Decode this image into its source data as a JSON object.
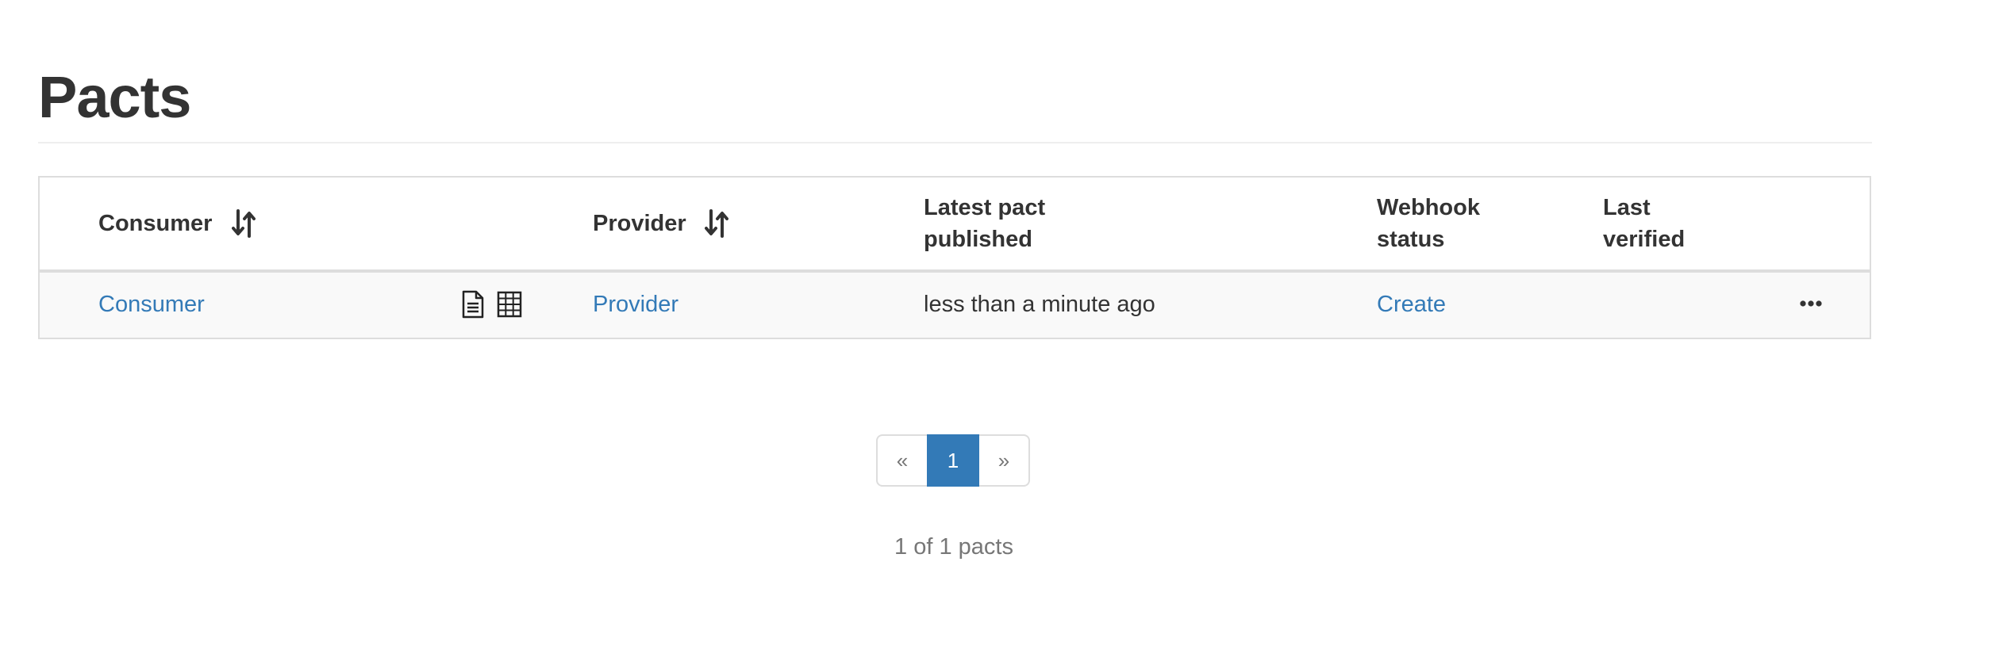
{
  "page": {
    "title": "Pacts"
  },
  "table": {
    "headers": {
      "consumer": "Consumer",
      "provider": "Provider",
      "latest_pact_line1": "Latest pact",
      "latest_pact_line2": "published",
      "webhook_line1": "Webhook",
      "webhook_line2": "status",
      "last_verified_line1": "Last",
      "last_verified_line2": "verified"
    },
    "icons": {
      "consumer_sort": "sort-icon",
      "provider_sort": "sort-icon",
      "row_document": "document-icon",
      "row_matrix": "matrix-grid-icon",
      "row_more": "ellipsis-icon"
    },
    "rows": [
      {
        "consumer": "Consumer",
        "provider": "Provider",
        "latest_pact_published": "less than a minute ago",
        "webhook_status": "Create",
        "last_verified": ""
      }
    ]
  },
  "pagination": {
    "prev": "«",
    "current": "1",
    "next": "»",
    "summary": "1 of 1 pacts"
  },
  "colors": {
    "link": "#337ab7",
    "text": "#333333",
    "muted": "#777777",
    "border": "#dddddd",
    "row_stripe": "#f9f9f9"
  }
}
